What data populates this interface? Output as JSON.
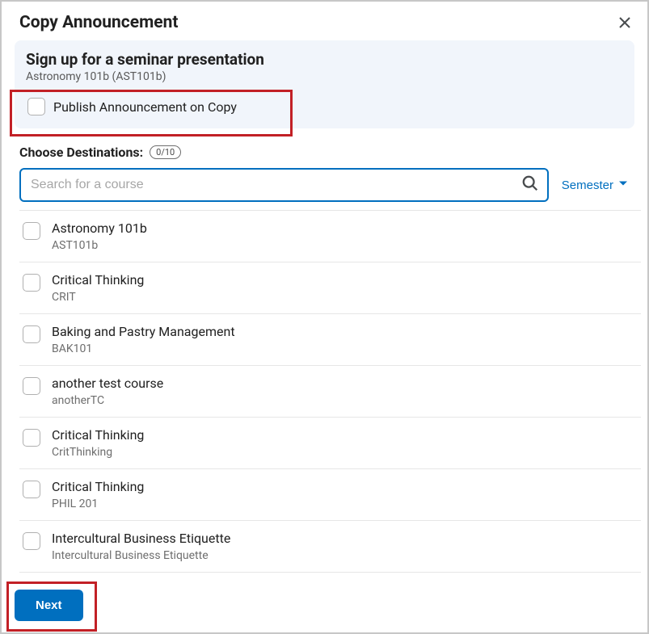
{
  "dialog": {
    "title": "Copy Announcement"
  },
  "banner": {
    "title": "Sign up for a seminar presentation",
    "subtitle": "Astronomy 101b (AST101b)",
    "publish_label": "Publish Announcement on Copy"
  },
  "destinations": {
    "label": "Choose Destinations:",
    "counter": "0/10",
    "search_placeholder": "Search for a course",
    "filter_label": "Semester"
  },
  "courses": [
    {
      "name": "Astronomy 101b",
      "code": "AST101b"
    },
    {
      "name": "Critical Thinking",
      "code": "CRIT"
    },
    {
      "name": "Baking and Pastry Management",
      "code": "BAK101"
    },
    {
      "name": "another test course",
      "code": "anotherTC"
    },
    {
      "name": "Critical Thinking",
      "code": "CritThinking"
    },
    {
      "name": "Critical Thinking",
      "code": "PHIL 201"
    },
    {
      "name": "Intercultural Business Etiquette",
      "code": "Intercultural Business Etiquette"
    }
  ],
  "footer": {
    "next_label": "Next"
  }
}
